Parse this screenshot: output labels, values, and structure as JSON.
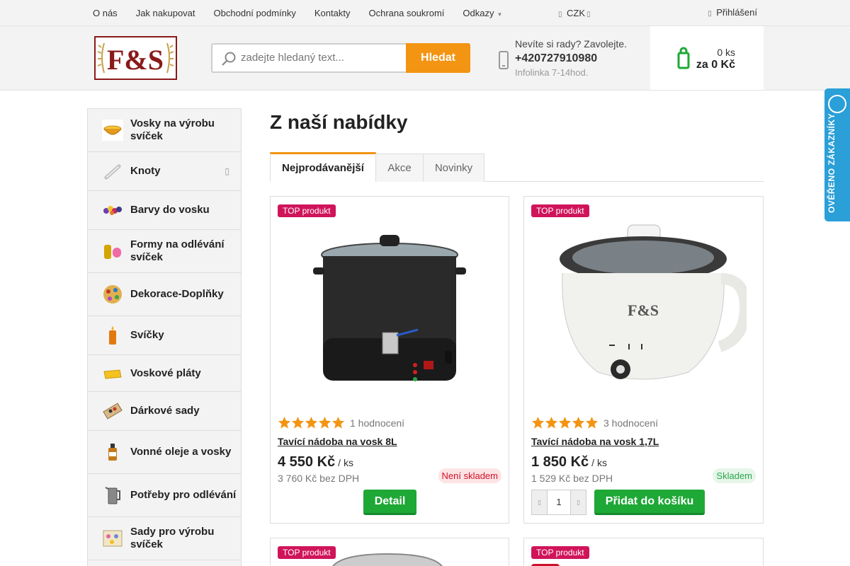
{
  "topnav": {
    "items": [
      "O nás",
      "Jak nakupovat",
      "Obchodní podmínky",
      "Kontakty",
      "Ochrana soukromí",
      "Odkazy"
    ],
    "currency": "CZK",
    "login": "Přihlášení"
  },
  "header": {
    "logo_text": "F&S",
    "search_placeholder": "zadejte hledaný text...",
    "search_button": "Hledat",
    "help_question": "Nevíte si rady? Zavolejte.",
    "phone": "+420727910980",
    "hours": "Infolinka 7-14hod.",
    "cart_count": "0 ks",
    "cart_total": "za 0 Kč"
  },
  "verified_badge": "OVĚŘENO ZÁKAZNÍKY",
  "sidebar": {
    "categories": [
      {
        "label": "Vosky na výrobu svíček",
        "icon": "wax-bowl-icon"
      },
      {
        "label": "Knoty",
        "icon": "wick-icon",
        "has_submenu": true
      },
      {
        "label": "Barvy do vosku",
        "icon": "dye-icon"
      },
      {
        "label": "Formy na odlévání svíček",
        "icon": "mold-icon"
      },
      {
        "label": "Dekorace-Doplňky",
        "icon": "decoration-icon"
      },
      {
        "label": "Svíčky",
        "icon": "candle-icon"
      },
      {
        "label": "Voskové pláty",
        "icon": "wax-sheet-icon"
      },
      {
        "label": "Dárkové sady",
        "icon": "gift-set-icon"
      },
      {
        "label": "Vonné oleje a vosky",
        "icon": "oil-bottle-icon"
      },
      {
        "label": "Potřeby pro odlévání",
        "icon": "pouring-pitcher-icon"
      },
      {
        "label": "Sady pro výrobu svíček",
        "icon": "kit-icon"
      }
    ]
  },
  "main": {
    "title": "Z naší nabídky",
    "tabs": [
      "Nejprodávanější",
      "Akce",
      "Novinky"
    ],
    "active_tab": "Nejprodávanější"
  },
  "products": [
    {
      "badge": "TOP produkt",
      "rating": 5,
      "reviews": "1 hodnocení",
      "name": "Tavící nádoba na vosk 8L",
      "price": "4 550 Kč",
      "unit": "/ ks",
      "price_net": "3 760 Kč bez DPH",
      "stock": "Není skladem",
      "button": "Detail"
    },
    {
      "badge": "TOP produkt",
      "rating": 5,
      "reviews": "3 hodnocení",
      "name": "Tavící nádoba na vosk 1,7L",
      "price": "1 850 Kč",
      "unit": "/ ks",
      "price_net": "1 529 Kč bez DPH",
      "stock": "Skladem",
      "quantity": "1",
      "button": "Přidat do košíku"
    },
    {
      "badge": "TOP produkt"
    },
    {
      "badge": "TOP produkt"
    }
  ],
  "colors": {
    "accent_orange": "#f39412",
    "green_button": "#1ea836",
    "top_badge": "#d0145a",
    "verified_blue": "#2a9fd8"
  }
}
